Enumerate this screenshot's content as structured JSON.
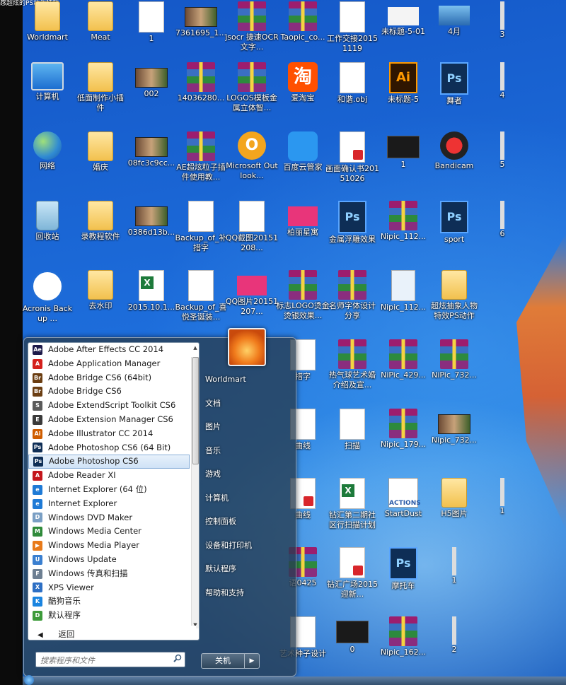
{
  "desktop": {
    "title_fragment": "感超炫的PS动作特效",
    "icons": [
      {
        "label": "Worldmart",
        "kind": "folder",
        "col": 0,
        "row": 0
      },
      {
        "label": "Meat",
        "kind": "folder",
        "col": 1,
        "row": 0
      },
      {
        "label": "1",
        "kind": "word",
        "col": 2,
        "row": 0
      },
      {
        "label": "7361695_1...",
        "kind": "thumb",
        "col": 3,
        "row": 0
      },
      {
        "label": "jsocr 捷速OCR文字...",
        "kind": "rar",
        "col": 4,
        "row": 0
      },
      {
        "label": "Taopic_co...",
        "kind": "rar",
        "col": 5,
        "row": 0
      },
      {
        "label": "工作交接20151119",
        "kind": "word",
        "col": 6,
        "row": 0
      },
      {
        "label": "未标题-5-01",
        "kind": "sign",
        "col": 7,
        "row": 0
      },
      {
        "label": "4月",
        "kind": "ship",
        "col": 8,
        "row": 0
      },
      {
        "label": "3",
        "kind": "bar",
        "col": 9,
        "row": 0
      },
      {
        "label": "计算机",
        "kind": "computer",
        "col": 0,
        "row": 1
      },
      {
        "label": "低面制作小插件",
        "kind": "folder",
        "col": 1,
        "row": 1
      },
      {
        "label": "002",
        "kind": "thumb",
        "col": 2,
        "row": 1
      },
      {
        "label": "14036280...",
        "kind": "rar",
        "col": 3,
        "row": 1
      },
      {
        "label": "LOGOS模板金属立体智...",
        "kind": "rar",
        "col": 4,
        "row": 1
      },
      {
        "label": "爱淘宝",
        "kind": "taobao",
        "col": 5,
        "row": 1
      },
      {
        "label": "和谐.obj",
        "kind": "white",
        "col": 6,
        "row": 1
      },
      {
        "label": "未标题-5",
        "kind": "ai",
        "col": 7,
        "row": 1
      },
      {
        "label": "舞者",
        "kind": "psd",
        "col": 8,
        "row": 1
      },
      {
        "label": "4",
        "kind": "bar",
        "col": 9,
        "row": 1
      },
      {
        "label": "网络",
        "kind": "globe",
        "col": 0,
        "row": 2
      },
      {
        "label": "婚庆",
        "kind": "folder",
        "col": 1,
        "row": 2
      },
      {
        "label": "08fc3c9cc...",
        "kind": "thumb",
        "col": 2,
        "row": 2
      },
      {
        "label": "AE超炫粒子插件使用教...",
        "kind": "rar",
        "col": 3,
        "row": 2
      },
      {
        "label": "Microsoft Outlook...",
        "kind": "outlook",
        "col": 4,
        "row": 2
      },
      {
        "label": "百度云管家",
        "kind": "cloud",
        "col": 5,
        "row": 2
      },
      {
        "label": "画面确认书20151026",
        "kind": "pdf",
        "col": 6,
        "row": 2
      },
      {
        "label": "1",
        "kind": "black",
        "col": 7,
        "row": 2
      },
      {
        "label": "Bandicam",
        "kind": "bandicam",
        "col": 8,
        "row": 2
      },
      {
        "label": "5",
        "kind": "bar",
        "col": 9,
        "row": 2
      },
      {
        "label": "回收站",
        "kind": "trash",
        "col": 0,
        "row": 3
      },
      {
        "label": "录教程软件",
        "kind": "folder",
        "col": 1,
        "row": 3
      },
      {
        "label": "0386d13b...",
        "kind": "thumb",
        "col": 2,
        "row": 3
      },
      {
        "label": "Backup_of_补措字",
        "kind": "doc",
        "col": 3,
        "row": 3
      },
      {
        "label": "QQ截图20151208...",
        "kind": "white",
        "col": 4,
        "row": 3
      },
      {
        "label": "柏丽星寓",
        "kind": "pink",
        "col": 5,
        "row": 3
      },
      {
        "label": "金属浮雕效果",
        "kind": "psd",
        "col": 6,
        "row": 3
      },
      {
        "label": "Nipic_112...",
        "kind": "rar",
        "col": 7,
        "row": 3
      },
      {
        "label": "sport",
        "kind": "psd",
        "col": 8,
        "row": 3
      },
      {
        "label": "6",
        "kind": "bar",
        "col": 9,
        "row": 3
      },
      {
        "label": "Acronis Backup ...",
        "kind": "acronis",
        "col": 0,
        "row": 4
      },
      {
        "label": "去水印",
        "kind": "folder",
        "col": 1,
        "row": 4
      },
      {
        "label": "2015.10.1...",
        "kind": "excel",
        "col": 2,
        "row": 4
      },
      {
        "label": "Backup_of_喜悦圣诞装...",
        "kind": "doc",
        "col": 3,
        "row": 4
      },
      {
        "label": "QQ图片20151207...",
        "kind": "pink",
        "col": 4,
        "row": 4
      },
      {
        "label": "标志LOGO烫金烫银效果...",
        "kind": "rar",
        "col": 5,
        "row": 4
      },
      {
        "label": "名师字体设计分享",
        "kind": "rar",
        "col": 6,
        "row": 4
      },
      {
        "label": "Nipic_112...",
        "kind": "snow",
        "col": 7,
        "row": 4
      },
      {
        "label": "超炫抽象人物特效PS动作",
        "kind": "folder",
        "col": 8,
        "row": 4
      },
      {
        "label": "措字",
        "kind": "doc",
        "col": 5,
        "row": 5
      },
      {
        "label": "热气球艺术婚介绍及宣...",
        "kind": "rar",
        "col": 6,
        "row": 5
      },
      {
        "label": "NiPic_429...",
        "kind": "rar",
        "col": 7,
        "row": 5
      },
      {
        "label": "NiPic_732...",
        "kind": "rar",
        "col": 8,
        "row": 5
      },
      {
        "label": "曲线",
        "kind": "doc",
        "col": 5,
        "row": 6
      },
      {
        "label": "扫描",
        "kind": "doc",
        "col": 6,
        "row": 6
      },
      {
        "label": "Nipic_179...",
        "kind": "rar",
        "col": 7,
        "row": 6
      },
      {
        "label": "Nipic_732...",
        "kind": "thumb",
        "col": 8,
        "row": 6
      },
      {
        "label": "曲线",
        "kind": "pdf",
        "col": 5,
        "row": 7
      },
      {
        "label": "钻汇第二期社区行扫描计划",
        "kind": "excel",
        "col": 6,
        "row": 7
      },
      {
        "label": "StartDust",
        "kind": "actions",
        "col": 7,
        "row": 7
      },
      {
        "label": "H5图片",
        "kind": "folder",
        "col": 8,
        "row": 7
      },
      {
        "label": "1",
        "kind": "bar",
        "col": 9,
        "row": 7
      },
      {
        "label": "语0425",
        "kind": "rar",
        "col": 5,
        "row": 8
      },
      {
        "label": "钻汇广场2015迎新...",
        "kind": "pdf",
        "col": 6,
        "row": 8
      },
      {
        "label": "摩托车",
        "kind": "psd",
        "col": 7,
        "row": 8
      },
      {
        "label": "1",
        "kind": "bar",
        "col": 8,
        "row": 8
      },
      {
        "label": "艺术种子设计",
        "kind": "word",
        "col": 5,
        "row": 9
      },
      {
        "label": "0",
        "kind": "black",
        "col": 6,
        "row": 9
      },
      {
        "label": "Nipic_162...",
        "kind": "rar",
        "col": 7,
        "row": 9
      },
      {
        "label": "2",
        "kind": "bar",
        "col": 8,
        "row": 9
      }
    ]
  },
  "start_menu": {
    "programs": [
      {
        "label": "Adobe After Effects CC 2014",
        "icon": "ae-icon",
        "color": "#1d1a4a",
        "abbr": "Ae"
      },
      {
        "label": "Adobe Application Manager",
        "icon": "adobe-icon",
        "color": "#d4201c",
        "abbr": "A"
      },
      {
        "label": "Adobe Bridge CS6 (64bit)",
        "icon": "br-icon",
        "color": "#6b3e12",
        "abbr": "Br"
      },
      {
        "label": "Adobe Bridge CS6",
        "icon": "br-icon",
        "color": "#6b3e12",
        "abbr": "Br"
      },
      {
        "label": "Adobe ExtendScript Toolkit CS6",
        "icon": "script-icon",
        "color": "#5a5a5a",
        "abbr": "S"
      },
      {
        "label": "Adobe Extension Manager CS6",
        "icon": "ext-icon",
        "color": "#3a3a3a",
        "abbr": "E"
      },
      {
        "label": "Adobe Illustrator CC 2014",
        "icon": "ai-icon",
        "color": "#cf5d00",
        "abbr": "Ai"
      },
      {
        "label": "Adobe Photoshop CS6 (64 Bit)",
        "icon": "ps-icon",
        "color": "#0e2e56",
        "abbr": "Ps"
      },
      {
        "label": "Adobe Photoshop CS6",
        "icon": "ps-icon",
        "color": "#0e2e56",
        "abbr": "Ps",
        "selected": true
      },
      {
        "label": "Adobe Reader XI",
        "icon": "pdf-icon",
        "color": "#c4161c",
        "abbr": "A"
      },
      {
        "label": "Internet Explorer (64 位)",
        "icon": "ie-icon",
        "color": "#1e7ad6",
        "abbr": "e"
      },
      {
        "label": "Internet Explorer",
        "icon": "ie-icon",
        "color": "#1e7ad6",
        "abbr": "e"
      },
      {
        "label": "Windows DVD Maker",
        "icon": "dvd-icon",
        "color": "#7a9fc4",
        "abbr": "D"
      },
      {
        "label": "Windows Media Center",
        "icon": "media-center-icon",
        "color": "#2f8a3a",
        "abbr": "M"
      },
      {
        "label": "Windows Media Player",
        "icon": "media-player-icon",
        "color": "#e87a1a",
        "abbr": "▶"
      },
      {
        "label": "Windows Update",
        "icon": "update-icon",
        "color": "#3a7fd0",
        "abbr": "U"
      },
      {
        "label": "Windows 传真和扫描",
        "icon": "fax-icon",
        "color": "#6d7f92",
        "abbr": "F"
      },
      {
        "label": "XPS Viewer",
        "icon": "xps-icon",
        "color": "#2d6fc4",
        "abbr": "X"
      },
      {
        "label": "酷狗音乐",
        "icon": "kugou-icon",
        "color": "#1a84e0",
        "abbr": "K"
      },
      {
        "label": "默认程序",
        "icon": "default-programs-icon",
        "color": "#3d9b3a",
        "abbr": "D"
      }
    ],
    "back_label": "返回",
    "back_arrow": "◀",
    "search_placeholder": "搜索程序和文件",
    "right_items": [
      "Worldmart",
      "文档",
      "图片",
      "音乐",
      "游戏",
      "计算机",
      "控制面板",
      "设备和打印机",
      "默认程序",
      "帮助和支持"
    ],
    "shutdown_label": "关机",
    "shutdown_arrow": "▶",
    "scroll_up": "▲",
    "scroll_down": "▼"
  }
}
